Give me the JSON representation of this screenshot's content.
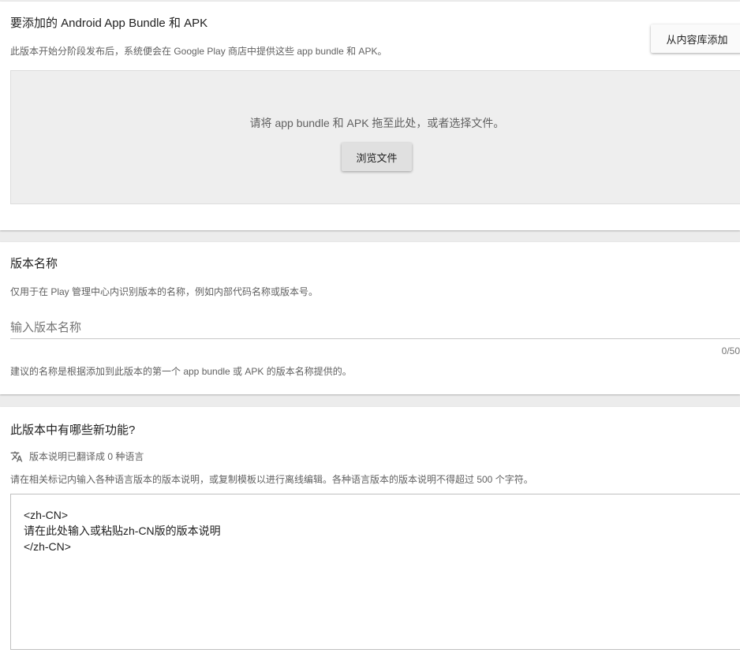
{
  "upload": {
    "title": "要添加的 Android App Bundle 和 APK",
    "description": "此版本开始分阶段发布后，系统便会在 Google Play 商店中提供这些 app bundle 和 APK。",
    "add_from_library_label": "从内容库添加",
    "dropzone_text": "请将 app bundle 和 APK 拖至此处，或者选择文件。",
    "browse_label": "浏览文件"
  },
  "release_name": {
    "title": "版本名称",
    "description": "仅用于在 Play 管理中心内识别版本的名称，例如内部代码名称或版本号。",
    "placeholder": "输入版本名称",
    "value": "",
    "counter": "0/50",
    "hint": "建议的名称是根据添加到此版本的第一个 app bundle 或 APK 的版本名称提供的。"
  },
  "release_notes": {
    "title": "此版本中有哪些新功能?",
    "translate_icon": "translate-icon",
    "translation_status": "版本说明已翻译成 0 种语言",
    "description": "请在相关标记内输入各种语言版本的版本说明，或复制模板以进行离线编辑。各种语言版本的版本说明不得超过 500 个字符。",
    "value": "<zh-CN>\n请在此处输入或粘贴zh-CN版的版本说明\n</zh-CN>"
  }
}
